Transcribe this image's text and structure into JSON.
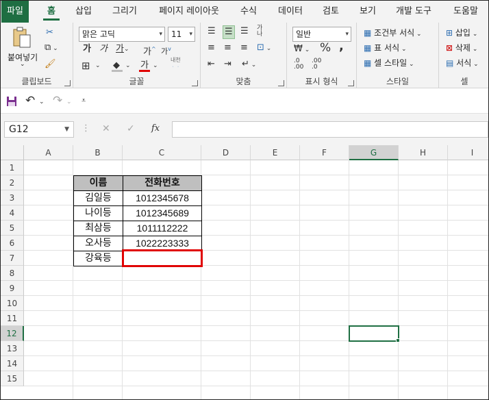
{
  "menu": {
    "tabs": [
      "파일",
      "홈",
      "삽입",
      "그리기",
      "페이지 레이아웃",
      "수식",
      "데이터",
      "검토",
      "보기",
      "개발 도구",
      "도움말"
    ]
  },
  "ribbon": {
    "clipboard": {
      "paste_label": "붙여넣기",
      "group_label": "클립보드"
    },
    "font": {
      "font_name": "맑은 고딕",
      "font_size": "11",
      "group_label": "글꼴",
      "bold": "가",
      "italic": "가",
      "underline": "가",
      "grow": "가",
      "shrink": "가",
      "font_color_glyph": "가",
      "phonetic": "내천"
    },
    "alignment": {
      "group_label": "맞춤"
    },
    "number": {
      "format": "일반",
      "group_label": "표시 형식"
    },
    "styles": {
      "conditional": "조건부 서식",
      "table": "표 서식",
      "cell": "셀 스타일",
      "group_label": "스타일"
    },
    "cells": {
      "insert": "삽입",
      "delete": "삭제",
      "format": "서식",
      "group_label": "셀"
    }
  },
  "formula_bar": {
    "name_box": "G12",
    "fx": "fx",
    "value": ""
  },
  "sheet": {
    "columns": [
      "A",
      "B",
      "C",
      "D",
      "E",
      "F",
      "G",
      "H",
      "I"
    ],
    "rows": [
      "1",
      "2",
      "3",
      "4",
      "5",
      "6",
      "7",
      "8",
      "9",
      "10",
      "11",
      "12",
      "13",
      "14",
      "15"
    ],
    "selected_col": "G",
    "selected_row": "12",
    "table": {
      "headers": [
        "이름",
        "전화번호"
      ],
      "rows": [
        [
          "김일등",
          "1012345678"
        ],
        [
          "나이등",
          "1012345689"
        ],
        [
          "최삼등",
          "1011112222"
        ],
        [
          "오사등",
          "1022223333"
        ],
        [
          "강육등",
          ""
        ]
      ]
    }
  },
  "colors": {
    "accent": "#1e6e42",
    "highlight_border": "#e00000",
    "header_fill": "#bfbfbf"
  }
}
